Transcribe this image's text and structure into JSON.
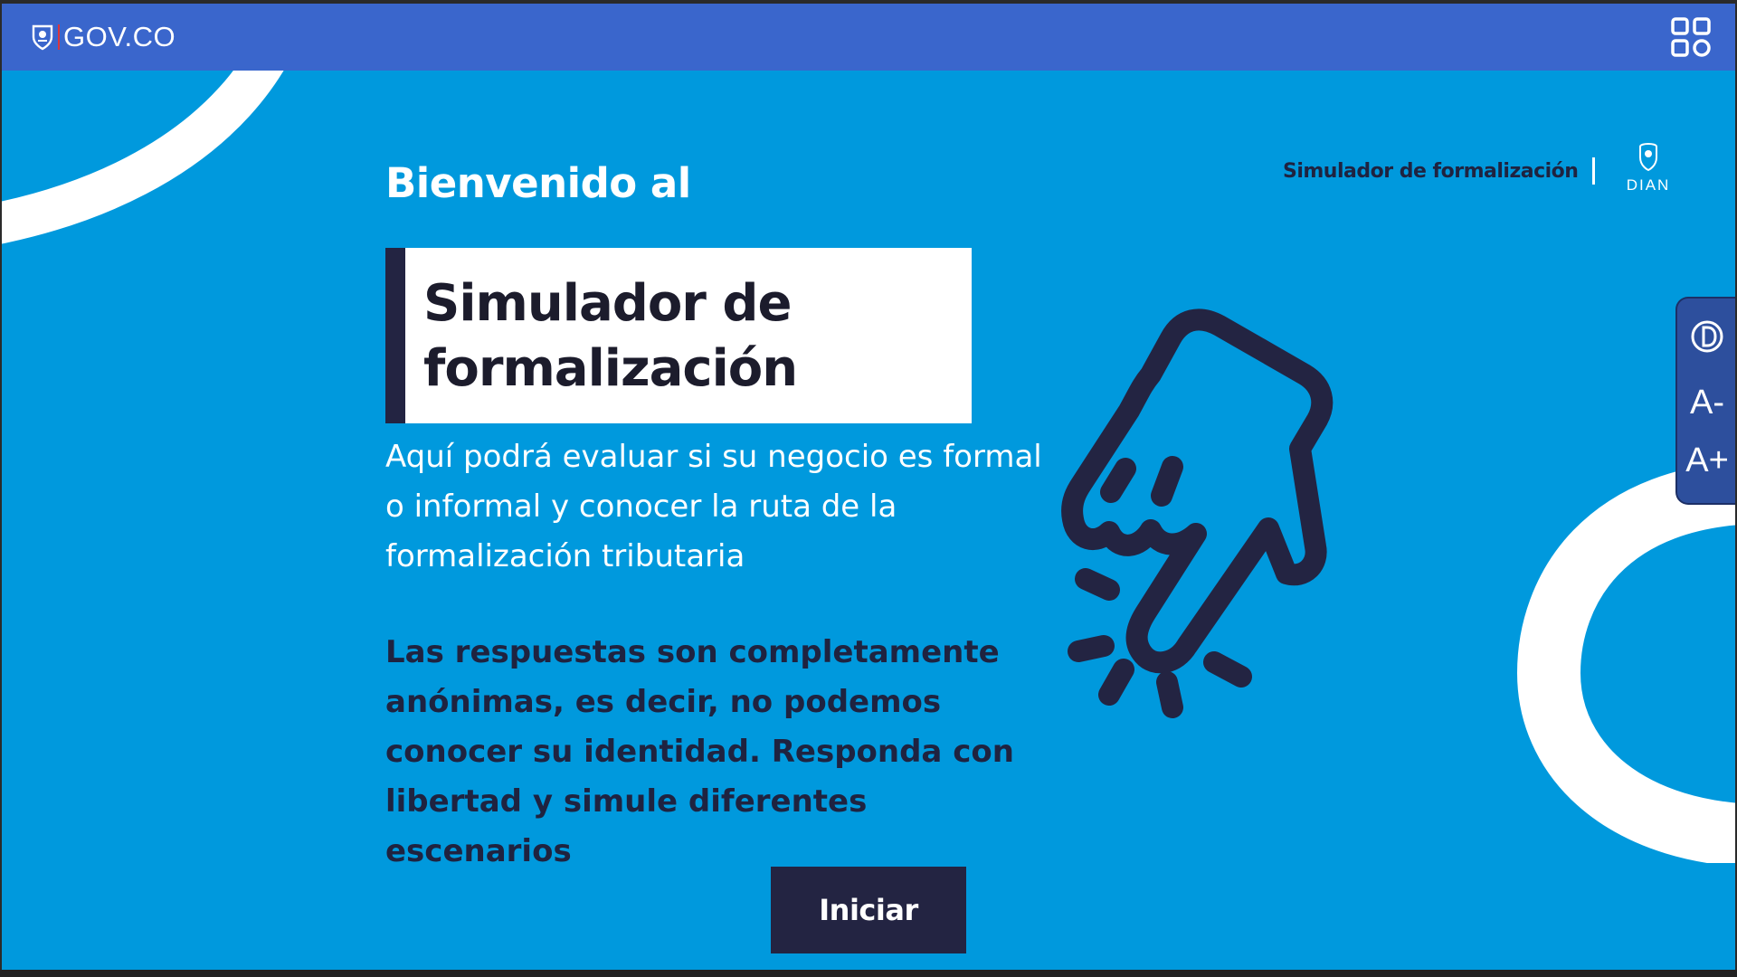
{
  "topbar": {
    "brand_text": "GOV.CO"
  },
  "header": {
    "title": "Simulador de formalización",
    "logo_text": "DIAN"
  },
  "main": {
    "welcome": "Bienvenido al",
    "card_title": "Simulador de formalización",
    "description": "Aquí podrá evaluar si su negocio es formal o informal y conocer la ruta de la formalización tributaria",
    "note": "Las respuestas son completamente anónimas, es decir, no podemos conocer su identidad. Responda con libertad y simule diferentes escenarios",
    "start_label": "Iniciar"
  },
  "accessibility": {
    "contrast_icon": "contrast-icon",
    "decrease_label": "A-",
    "increase_label": "A+"
  },
  "colors": {
    "background": "#0099dd",
    "topbar": "#3a66cc",
    "dark": "#232442",
    "panel": "#2d4f9d"
  }
}
